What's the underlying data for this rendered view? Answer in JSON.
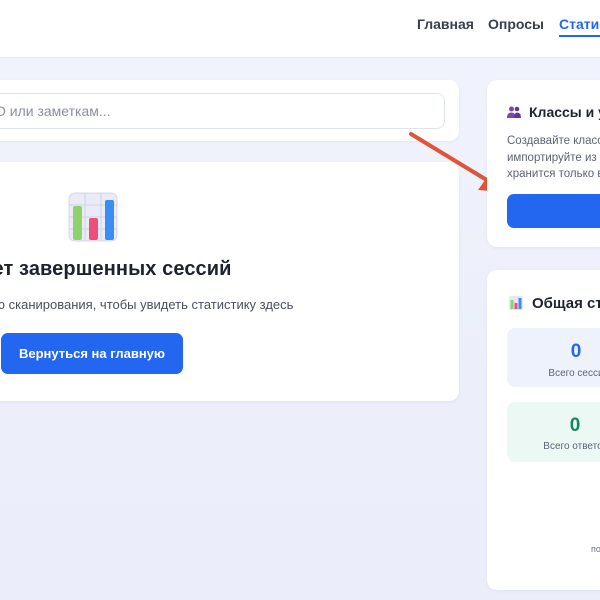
{
  "nav": {
    "items": [
      {
        "label": "Главная",
        "active": false
      },
      {
        "label": "Опросы",
        "active": false
      },
      {
        "label": "Статис",
        "active": true
      }
    ]
  },
  "search": {
    "placeholder": "О или заметкам..."
  },
  "empty_state": {
    "icon": "bar-chart-icon",
    "title": "Нет завершенных сессий",
    "subtitle": "ию сканирования, чтобы увидеть статистику здесь",
    "button_label": "Вернуться на главную"
  },
  "classes_card": {
    "icon": "people-icon",
    "title": "Классы и у",
    "description_lines": [
      "Создавайте класс",
      "импортируйте из",
      "хранится только в"
    ]
  },
  "stats_card": {
    "icon": "bar-chart-icon",
    "title": "Общая ст",
    "tiles": [
      {
        "value": "0",
        "label": "Всего сесси"
      },
      {
        "value": "0",
        "label": "Всего ответо"
      }
    ],
    "footer_fragment": "по"
  },
  "colors": {
    "accent": "#2366f0",
    "arrow": "#e0553a",
    "green": "#118a60"
  }
}
